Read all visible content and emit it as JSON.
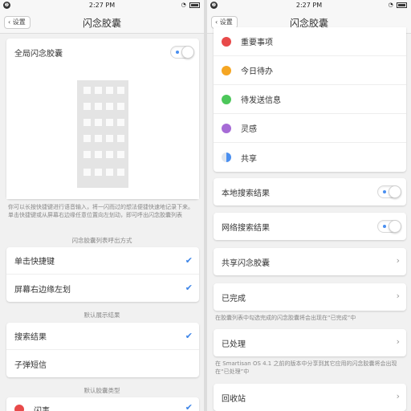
{
  "left": {
    "status": {
      "time": "2:27 PM",
      "notif": "❷"
    },
    "nav": {
      "back_label": "设置",
      "title": "闪念胶囊"
    },
    "global_toggle_label": "全局闪念胶囊",
    "description": "你可以长按快捷键进行语音输入，将一闪而过的想法便捷快速地记录下来。单击快捷键或从屏幕右边缘任意位置向左划动，即可呼出闪念胶囊列表",
    "section_invoke": "闪念胶囊列表呼出方式",
    "invoke_options": [
      "单击快捷键",
      "屏幕右边缘左划"
    ],
    "section_default": "默认展示结果",
    "default_options": [
      "搜索结果",
      "子弹短信"
    ],
    "section_type": "默认胶囊类型",
    "type_partial": "闪事"
  },
  "right": {
    "status": {
      "time": "2:27 PM",
      "notif": "❷"
    },
    "nav": {
      "back_label": "设置",
      "title": "闪念胶囊"
    },
    "types": [
      {
        "label": "重要事项",
        "icon": "exclamation-icon",
        "color": "#e84a4a"
      },
      {
        "label": "今日待办",
        "icon": "star-icon",
        "color": "#f5a623"
      },
      {
        "label": "待发送信息",
        "icon": "dot-icon",
        "color": "#4cc75a"
      },
      {
        "label": "灵感",
        "icon": "bulb-icon",
        "color": "#a66bd6"
      },
      {
        "label": "共享",
        "icon": "half-circle-icon",
        "color": "#4a8ff0"
      }
    ],
    "local_search": "本地搜索结果",
    "web_search": "网络搜索结果",
    "shared_capsule": "共享闪念胶囊",
    "done": "已完成",
    "done_note": "在胶囊列表中勾选完成的闪念胶囊将会出现在“已完成”中",
    "processed": "已处理",
    "processed_note": "在 Smartisan OS 4.1 之前的版本中分享到其它应用的闪念胶囊将会出现在“已处理”中",
    "trash": "回收站"
  }
}
